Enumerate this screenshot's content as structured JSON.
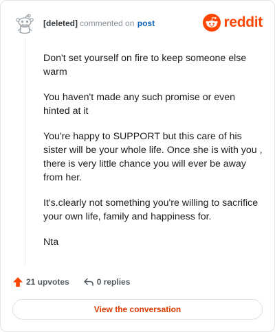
{
  "comment": {
    "author": "[deleted]",
    "action_text": "commented on",
    "target_link": "post",
    "avatar_icon": "snoo-avatar-icon",
    "paragraphs": [
      "Don't set yourself on fire to keep someone else warm",
      "You haven't made any such promise or even hinted at it",
      "You're happy to SUPPORT but this care of his sister will be your whole life. Once she is with you , there is very little chance you will ever be away from her.",
      "It's.clearly not something you're willing to sacrifice your own life, family and happiness for.",
      "Nta"
    ]
  },
  "brand": {
    "name": "reddit",
    "icon": "reddit-logo-icon",
    "color": "#ff4500"
  },
  "actions": {
    "upvotes_label": "21 upvotes",
    "upvote_icon": "upvote-arrow-icon",
    "replies_label": "0 replies",
    "reply_icon": "reply-arrow-icon"
  },
  "cta": {
    "label": "View the conversation"
  },
  "colors": {
    "accent": "#ff4500",
    "cta_text": "#d93a00",
    "link": "#0f5fb6"
  }
}
